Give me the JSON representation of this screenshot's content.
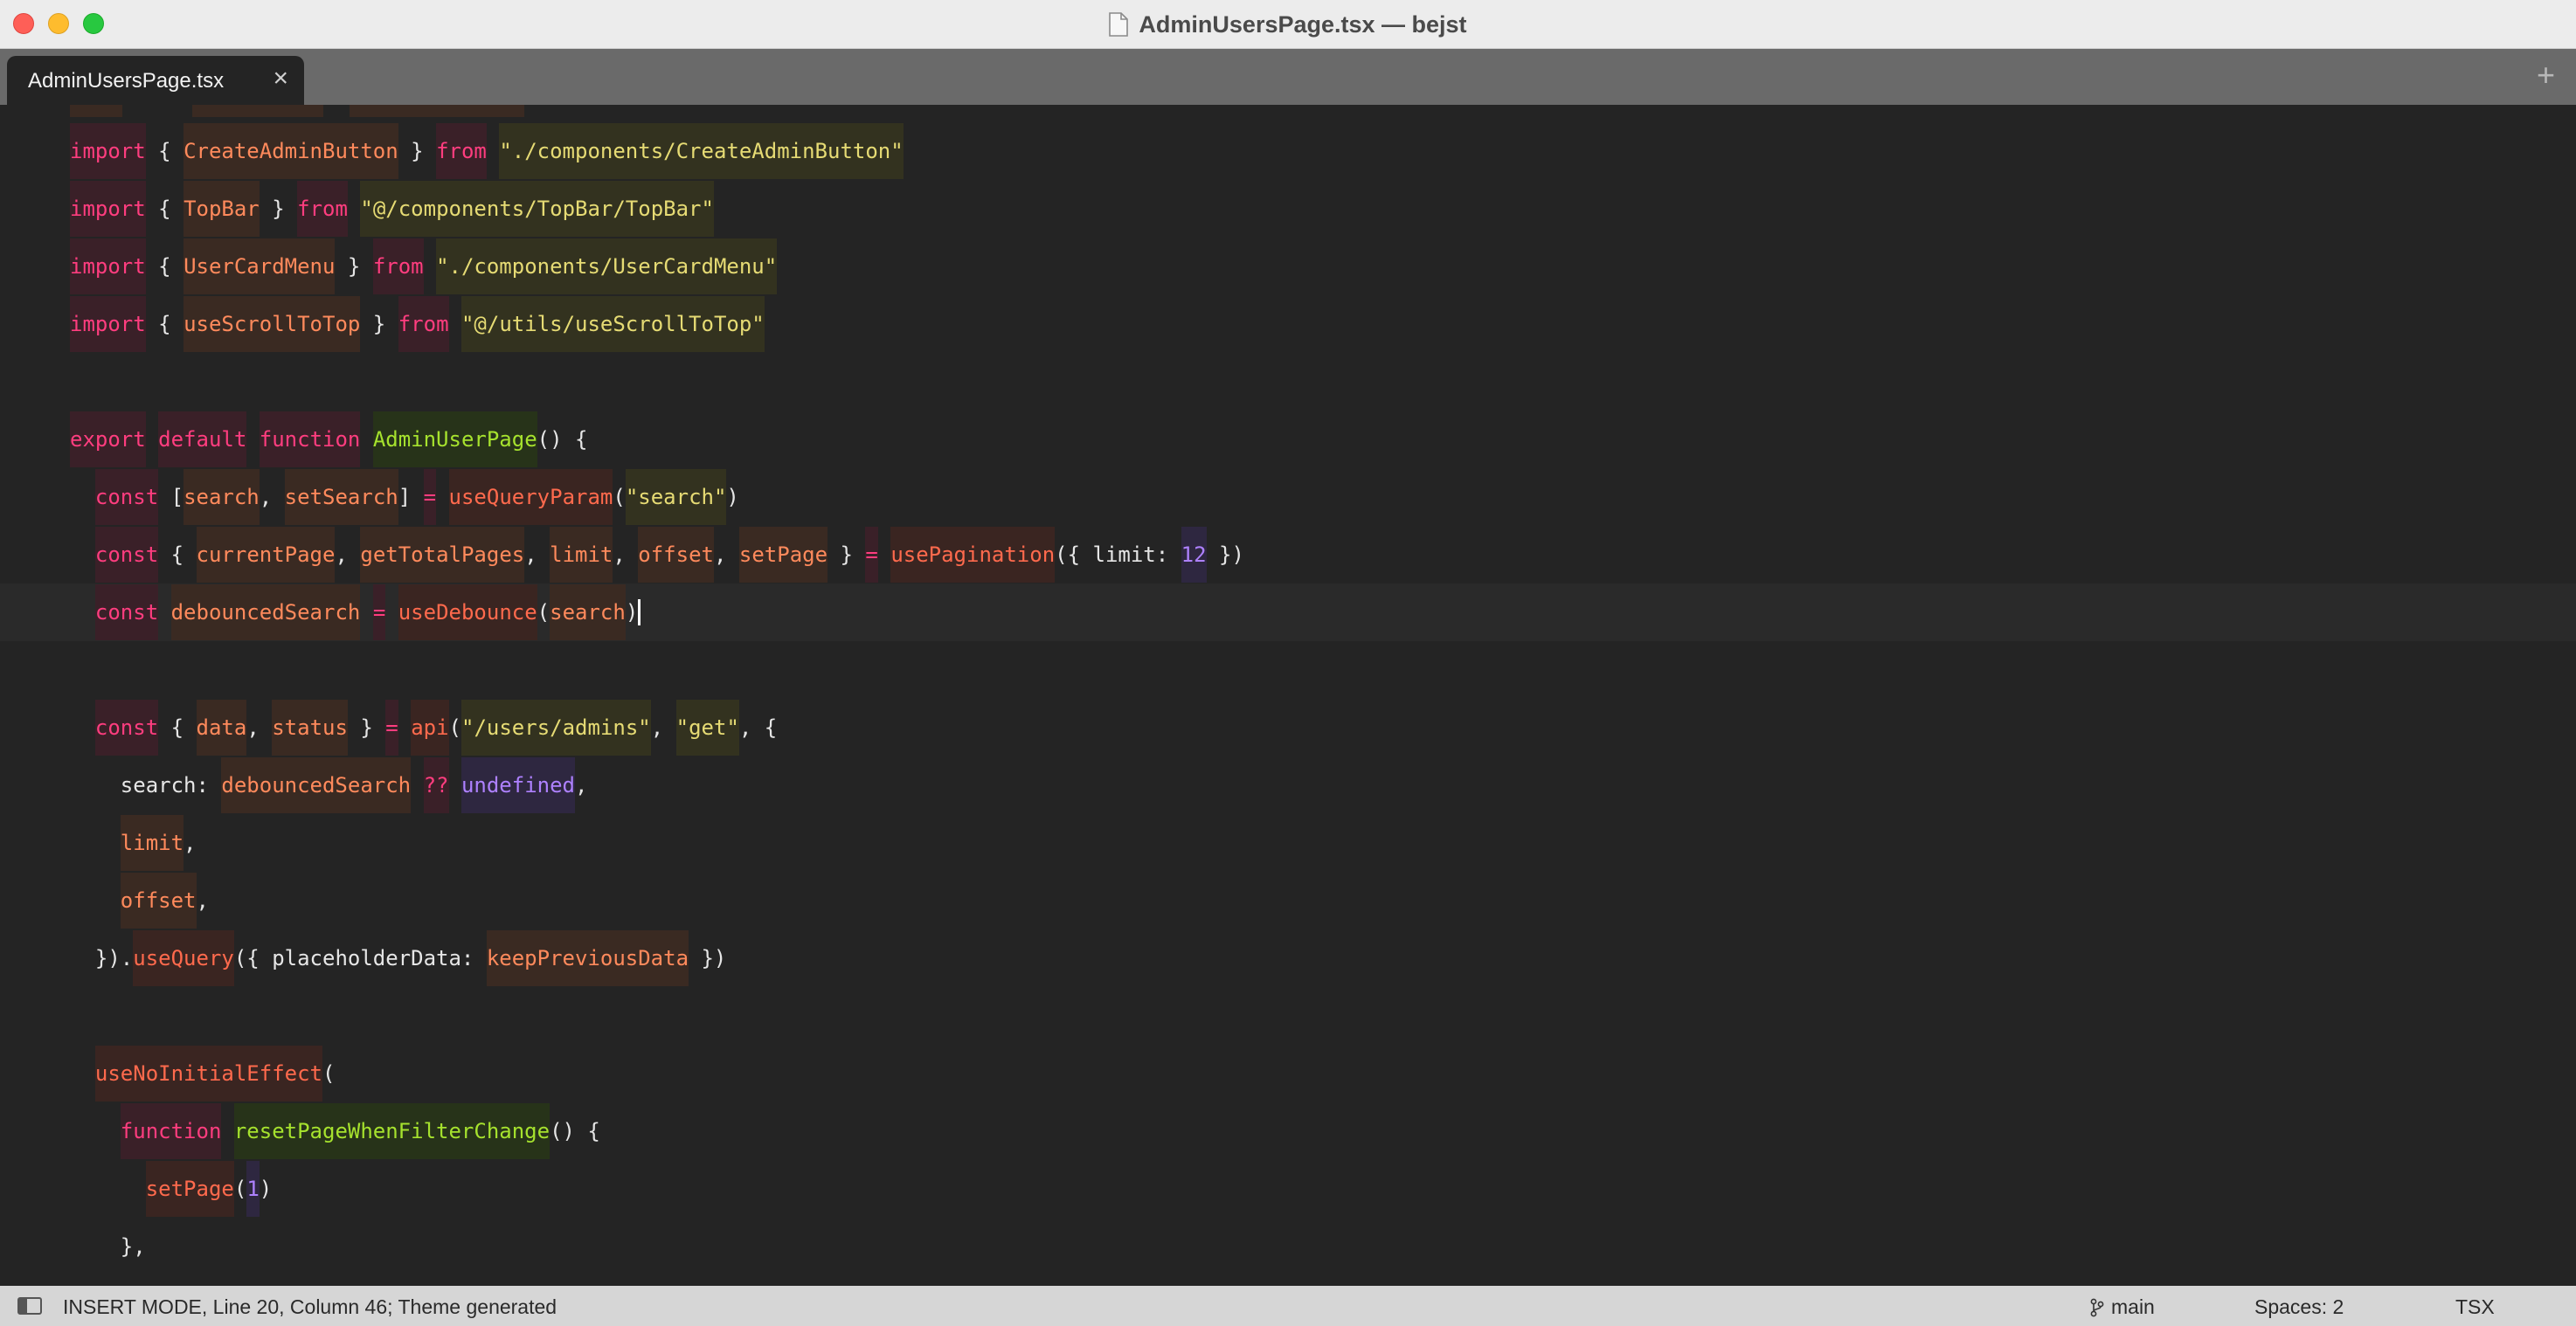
{
  "window": {
    "title": "AdminUsersPage.tsx — bejst"
  },
  "tabs": [
    {
      "label": "AdminUsersPage.tsx",
      "close_icon": "×"
    }
  ],
  "tab_add_icon": "+",
  "code_lines": [
    {
      "tokens": [
        {
          "t": "import",
          "c": "kw"
        },
        {
          "t": " { ",
          "c": "pl"
        },
        {
          "t": "CreateAdminButton",
          "c": "id"
        },
        {
          "t": " } ",
          "c": "pl"
        },
        {
          "t": "from",
          "c": "kw"
        },
        {
          "t": " ",
          "c": "pl"
        },
        {
          "t": "\"./components/CreateAdminButton\"",
          "c": "str"
        }
      ]
    },
    {
      "tokens": [
        {
          "t": "import",
          "c": "kw"
        },
        {
          "t": " { ",
          "c": "pl"
        },
        {
          "t": "TopBar",
          "c": "id"
        },
        {
          "t": " } ",
          "c": "pl"
        },
        {
          "t": "from",
          "c": "kw"
        },
        {
          "t": " ",
          "c": "pl"
        },
        {
          "t": "\"@/components/TopBar/TopBar\"",
          "c": "str"
        }
      ]
    },
    {
      "tokens": [
        {
          "t": "import",
          "c": "kw"
        },
        {
          "t": " { ",
          "c": "pl"
        },
        {
          "t": "UserCardMenu",
          "c": "id"
        },
        {
          "t": " } ",
          "c": "pl"
        },
        {
          "t": "from",
          "c": "kw"
        },
        {
          "t": " ",
          "c": "pl"
        },
        {
          "t": "\"./components/UserCardMenu\"",
          "c": "str"
        }
      ]
    },
    {
      "tokens": [
        {
          "t": "import",
          "c": "kw"
        },
        {
          "t": " { ",
          "c": "pl"
        },
        {
          "t": "useScrollToTop",
          "c": "id"
        },
        {
          "t": " } ",
          "c": "pl"
        },
        {
          "t": "from",
          "c": "kw"
        },
        {
          "t": " ",
          "c": "pl"
        },
        {
          "t": "\"@/utils/useScrollToTop\"",
          "c": "str"
        }
      ]
    },
    {
      "tokens": []
    },
    {
      "tokens": [
        {
          "t": "export",
          "c": "kw"
        },
        {
          "t": " ",
          "c": "pl"
        },
        {
          "t": "default",
          "c": "kw"
        },
        {
          "t": " ",
          "c": "pl"
        },
        {
          "t": "function",
          "c": "kw"
        },
        {
          "t": " ",
          "c": "pl"
        },
        {
          "t": "AdminUserPage",
          "c": "def"
        },
        {
          "t": "() {",
          "c": "pl"
        }
      ]
    },
    {
      "tokens": [
        {
          "t": "  ",
          "c": "pl"
        },
        {
          "t": "const",
          "c": "kw"
        },
        {
          "t": " [",
          "c": "pl"
        },
        {
          "t": "search",
          "c": "id"
        },
        {
          "t": ", ",
          "c": "pl"
        },
        {
          "t": "setSearch",
          "c": "id"
        },
        {
          "t": "] ",
          "c": "pl"
        },
        {
          "t": "=",
          "c": "op"
        },
        {
          "t": " ",
          "c": "pl"
        },
        {
          "t": "useQueryParam",
          "c": "fn"
        },
        {
          "t": "(",
          "c": "pl"
        },
        {
          "t": "\"search\"",
          "c": "str"
        },
        {
          "t": ")",
          "c": "pl"
        }
      ]
    },
    {
      "tokens": [
        {
          "t": "  ",
          "c": "pl"
        },
        {
          "t": "const",
          "c": "kw"
        },
        {
          "t": " { ",
          "c": "pl"
        },
        {
          "t": "currentPage",
          "c": "id"
        },
        {
          "t": ", ",
          "c": "pl"
        },
        {
          "t": "getTotalPages",
          "c": "id"
        },
        {
          "t": ", ",
          "c": "pl"
        },
        {
          "t": "limit",
          "c": "id"
        },
        {
          "t": ", ",
          "c": "pl"
        },
        {
          "t": "offset",
          "c": "id"
        },
        {
          "t": ", ",
          "c": "pl"
        },
        {
          "t": "setPage",
          "c": "id"
        },
        {
          "t": " } ",
          "c": "pl"
        },
        {
          "t": "=",
          "c": "op"
        },
        {
          "t": " ",
          "c": "pl"
        },
        {
          "t": "usePagination",
          "c": "fn"
        },
        {
          "t": "({ limit: ",
          "c": "pl"
        },
        {
          "t": "12",
          "c": "num"
        },
        {
          "t": " })",
          "c": "pl"
        }
      ]
    },
    {
      "current": true,
      "tokens": [
        {
          "t": "  ",
          "c": "pl"
        },
        {
          "t": "const",
          "c": "kw"
        },
        {
          "t": " ",
          "c": "pl"
        },
        {
          "t": "debouncedSearch",
          "c": "id"
        },
        {
          "t": " ",
          "c": "pl"
        },
        {
          "t": "=",
          "c": "op"
        },
        {
          "t": " ",
          "c": "pl"
        },
        {
          "t": "useDebounce",
          "c": "fn"
        },
        {
          "t": "(",
          "c": "pl"
        },
        {
          "t": "search",
          "c": "id"
        },
        {
          "t": ")",
          "c": "pl"
        }
      ]
    },
    {
      "tokens": []
    },
    {
      "tokens": [
        {
          "t": "  ",
          "c": "pl"
        },
        {
          "t": "const",
          "c": "kw"
        },
        {
          "t": " { ",
          "c": "pl"
        },
        {
          "t": "data",
          "c": "id"
        },
        {
          "t": ", ",
          "c": "pl"
        },
        {
          "t": "status",
          "c": "id"
        },
        {
          "t": " } ",
          "c": "pl"
        },
        {
          "t": "=",
          "c": "op"
        },
        {
          "t": " ",
          "c": "pl"
        },
        {
          "t": "api",
          "c": "fn"
        },
        {
          "t": "(",
          "c": "pl"
        },
        {
          "t": "\"/users/admins\"",
          "c": "str"
        },
        {
          "t": ", ",
          "c": "pl"
        },
        {
          "t": "\"get\"",
          "c": "str"
        },
        {
          "t": ", {",
          "c": "pl"
        }
      ]
    },
    {
      "tokens": [
        {
          "t": "    search: ",
          "c": "pl"
        },
        {
          "t": "debouncedSearch",
          "c": "id"
        },
        {
          "t": " ",
          "c": "pl"
        },
        {
          "t": "??",
          "c": "op"
        },
        {
          "t": " ",
          "c": "pl"
        },
        {
          "t": "undefined",
          "c": "und"
        },
        {
          "t": ",",
          "c": "pl"
        }
      ]
    },
    {
      "tokens": [
        {
          "t": "    ",
          "c": "pl"
        },
        {
          "t": "limit",
          "c": "id"
        },
        {
          "t": ",",
          "c": "pl"
        }
      ]
    },
    {
      "tokens": [
        {
          "t": "    ",
          "c": "pl"
        },
        {
          "t": "offset",
          "c": "id"
        },
        {
          "t": ",",
          "c": "pl"
        }
      ]
    },
    {
      "tokens": [
        {
          "t": "  }).",
          "c": "pl"
        },
        {
          "t": "useQuery",
          "c": "fn"
        },
        {
          "t": "({ placeholderData: ",
          "c": "pl"
        },
        {
          "t": "keepPreviousData",
          "c": "id"
        },
        {
          "t": " })",
          "c": "pl"
        }
      ]
    },
    {
      "tokens": []
    },
    {
      "tokens": [
        {
          "t": "  ",
          "c": "pl"
        },
        {
          "t": "useNoInitialEffect",
          "c": "fn"
        },
        {
          "t": "(",
          "c": "pl"
        }
      ]
    },
    {
      "tokens": [
        {
          "t": "    ",
          "c": "pl"
        },
        {
          "t": "function",
          "c": "kw"
        },
        {
          "t": " ",
          "c": "pl"
        },
        {
          "t": "resetPageWhenFilterChange",
          "c": "def"
        },
        {
          "t": "() {",
          "c": "pl"
        }
      ]
    },
    {
      "tokens": [
        {
          "t": "      ",
          "c": "pl"
        },
        {
          "t": "setPage",
          "c": "fn"
        },
        {
          "t": "(",
          "c": "pl"
        },
        {
          "t": "1",
          "c": "num"
        },
        {
          "t": ")",
          "c": "pl"
        }
      ]
    },
    {
      "tokens": [
        {
          "t": "    },",
          "c": "pl"
        }
      ]
    }
  ],
  "statusbar": {
    "panel_icon": "sidebar-toggle-icon",
    "mode_text": "INSERT MODE, Line 20, Column 46; Theme generated",
    "branch": "main",
    "spaces": "Spaces: 2",
    "syntax": "TSX"
  }
}
